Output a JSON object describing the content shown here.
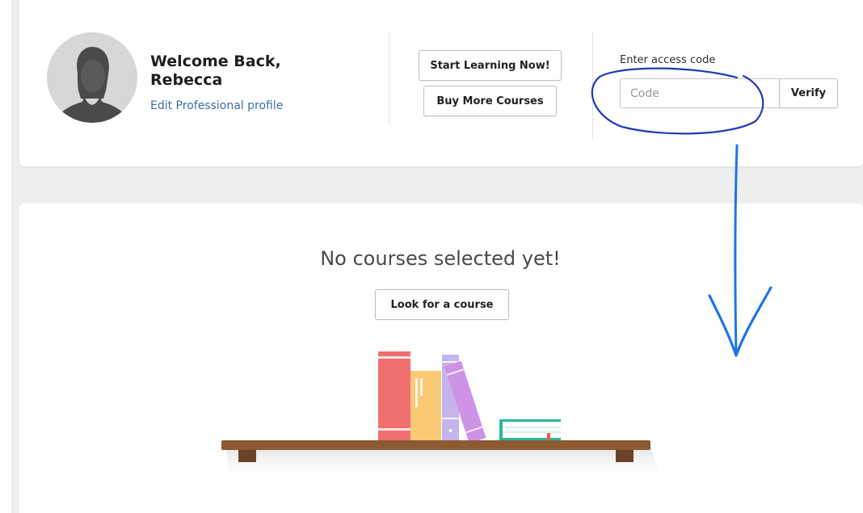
{
  "header": {
    "welcome": "Welcome Back, Rebecca",
    "edit_profile_link": "Edit Professional profile",
    "start_learning_button": "Start Learning Now!",
    "buy_courses_button": "Buy More Courses"
  },
  "access_code": {
    "label": "Enter access code",
    "placeholder": "Code",
    "value": "",
    "verify_button": "Verify"
  },
  "main": {
    "empty_message": "No courses selected yet!",
    "look_button": "Look for a course"
  },
  "colors": {
    "link": "#3d6ea8",
    "annotation_circle": "#1f3bb3",
    "annotation_arrow": "#1e74e8",
    "background_panel": "#eeeeef"
  },
  "icons": {
    "avatar": "user-silhouette-icon",
    "illustration": "bookshelf-illustration"
  }
}
